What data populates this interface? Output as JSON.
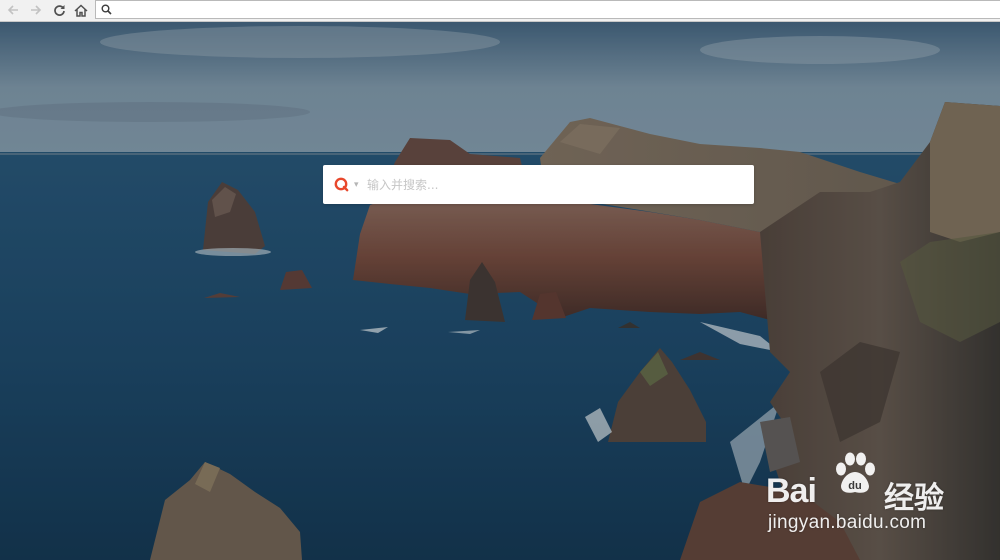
{
  "browser": {
    "back_icon": "arrow-left",
    "forward_icon": "arrow-right",
    "reload_icon": "reload",
    "home_icon": "home",
    "address_value": "",
    "address_icon": "search-icon"
  },
  "search": {
    "engine_icon": "search-engine-logo",
    "engine_color": "#e8482c",
    "caret": "▾",
    "placeholder": "输入并搜索..."
  },
  "watermark": {
    "brand_left": "Bai",
    "brand_right": "经验",
    "url": "jingyan.baidu.com"
  }
}
